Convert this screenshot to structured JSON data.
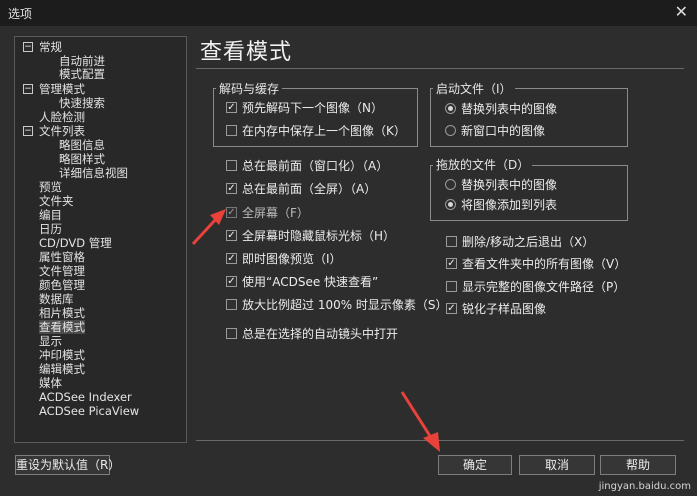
{
  "window": {
    "title": "选项",
    "close_glyph": "✕"
  },
  "tree": {
    "items": [
      {
        "label": "常规",
        "exp": "−"
      },
      {
        "label": "自动前进"
      },
      {
        "label": "模式配置"
      },
      {
        "label": "管理模式",
        "exp": "−"
      },
      {
        "label": "快速搜索"
      },
      {
        "label": "人脸检测"
      },
      {
        "label": "文件列表",
        "exp": "−"
      },
      {
        "label": "略图信息"
      },
      {
        "label": "略图样式"
      },
      {
        "label": "详细信息视图"
      },
      {
        "label": "预览"
      },
      {
        "label": "文件夹"
      },
      {
        "label": "编目"
      },
      {
        "label": "日历"
      },
      {
        "label": "CD/DVD 管理"
      },
      {
        "label": "属性窗格"
      },
      {
        "label": "文件管理"
      },
      {
        "label": "颜色管理"
      },
      {
        "label": "数据库"
      },
      {
        "label": "相片模式"
      },
      {
        "label": "查看模式",
        "selected": true
      },
      {
        "label": "显示"
      },
      {
        "label": "冲印模式"
      },
      {
        "label": "编辑模式"
      },
      {
        "label": "媒体"
      },
      {
        "label": "ACDSee Indexer"
      },
      {
        "label": "ACDSee PicaView"
      }
    ]
  },
  "main": {
    "heading": "查看模式",
    "decode_group": {
      "label": "解码与缓存",
      "options": [
        {
          "label": "预先解码下一个图像（N）",
          "checked": true
        },
        {
          "label": "在内存中保存上一个图像（K）",
          "checked": false
        }
      ]
    },
    "startup_group": {
      "label": "启动文件（I）",
      "options": [
        {
          "label": "替换列表中的图像",
          "selected": true
        },
        {
          "label": "新窗口中的图像",
          "selected": false
        }
      ]
    },
    "drag_group": {
      "label": "拖放的文件（D）",
      "options": [
        {
          "label": "替换列表中的图像",
          "selected": false
        },
        {
          "label": "将图像添加到列表",
          "selected": true
        }
      ]
    },
    "left_options": [
      {
        "label": "总在最前面（窗口化）（A）",
        "checked": false
      },
      {
        "label": "总在最前面（全屏）（A）",
        "checked": true
      },
      {
        "label": "全屏幕（F）",
        "checked": true,
        "disabled": true
      },
      {
        "label": "全屏幕时隐藏鼠标光标（H）",
        "checked": true
      },
      {
        "label": "即时图像预览（I）",
        "checked": true
      },
      {
        "label": "使用“ACDSee 快速查看”",
        "checked": true
      },
      {
        "label": "放大比例超过 100% 时显示像素（S）",
        "checked": false
      },
      {
        "label": "总是在选择的自动镜头中打开",
        "checked": false
      }
    ],
    "right_options": [
      {
        "label": "删除/移动之后退出（X）",
        "checked": false
      },
      {
        "label": "查看文件夹中的所有图像（V）",
        "checked": true
      },
      {
        "label": "显示完整的图像文件路径（P）",
        "checked": false
      },
      {
        "label": "锐化子样品图像",
        "checked": true
      }
    ]
  },
  "buttons": {
    "reset": "重设为默认值（R）",
    "ok": "确定",
    "cancel": "取消",
    "help": "帮助"
  },
  "watermark": "jingyan.baidu.com",
  "colors": {
    "arrow": "#e8423a",
    "bg": "#2d2d2d"
  }
}
